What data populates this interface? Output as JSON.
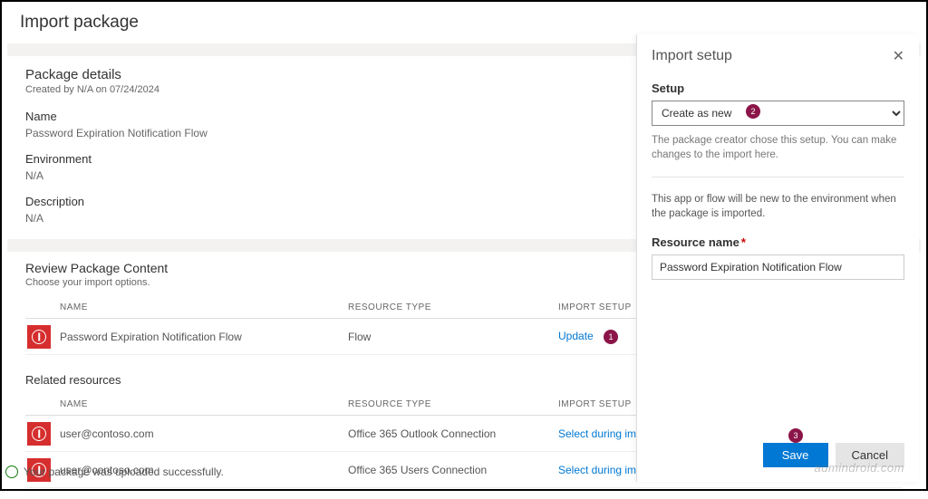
{
  "page_title": "Import package",
  "package": {
    "title": "Package details",
    "created_by": "Created by N/A on 07/24/2024",
    "name_label": "Name",
    "name_value": "Password Expiration Notification Flow",
    "env_label": "Environment",
    "env_value": "N/A",
    "desc_label": "Description",
    "desc_value": "N/A"
  },
  "review": {
    "title": "Review Package Content",
    "subtitle": "Choose your import options.",
    "headers": {
      "name": "NAME",
      "type": "RESOURCE TYPE",
      "setup": "IMPORT SETUP"
    },
    "rows": [
      {
        "name": "Password Expiration Notification Flow",
        "type": "Flow",
        "setup": "Update",
        "badge": "1"
      }
    ]
  },
  "related": {
    "title": "Related resources",
    "headers": {
      "name": "NAME",
      "type": "RESOURCE TYPE",
      "setup": "IMPORT SETUP"
    },
    "rows": [
      {
        "name": "user@contoso.com",
        "type": "Office 365 Outlook Connection",
        "setup": "Select during import"
      },
      {
        "name": "user@contoso.com",
        "type": "Office 365 Users Connection",
        "setup": "Select during import"
      }
    ]
  },
  "status": "Your package was uploaded successfully.",
  "panel": {
    "title": "Import setup",
    "setup_label": "Setup",
    "setup_value": "Create as new",
    "badge": "2",
    "help": "The package creator chose this setup. You can make changes to the import here.",
    "note": "This app or flow will be new to the environment when the package is imported.",
    "resource_label": "Resource name",
    "resource_value": "Password Expiration Notification Flow",
    "save": "Save",
    "cancel": "Cancel",
    "badge_save": "3"
  },
  "watermark": "admindroid.com"
}
